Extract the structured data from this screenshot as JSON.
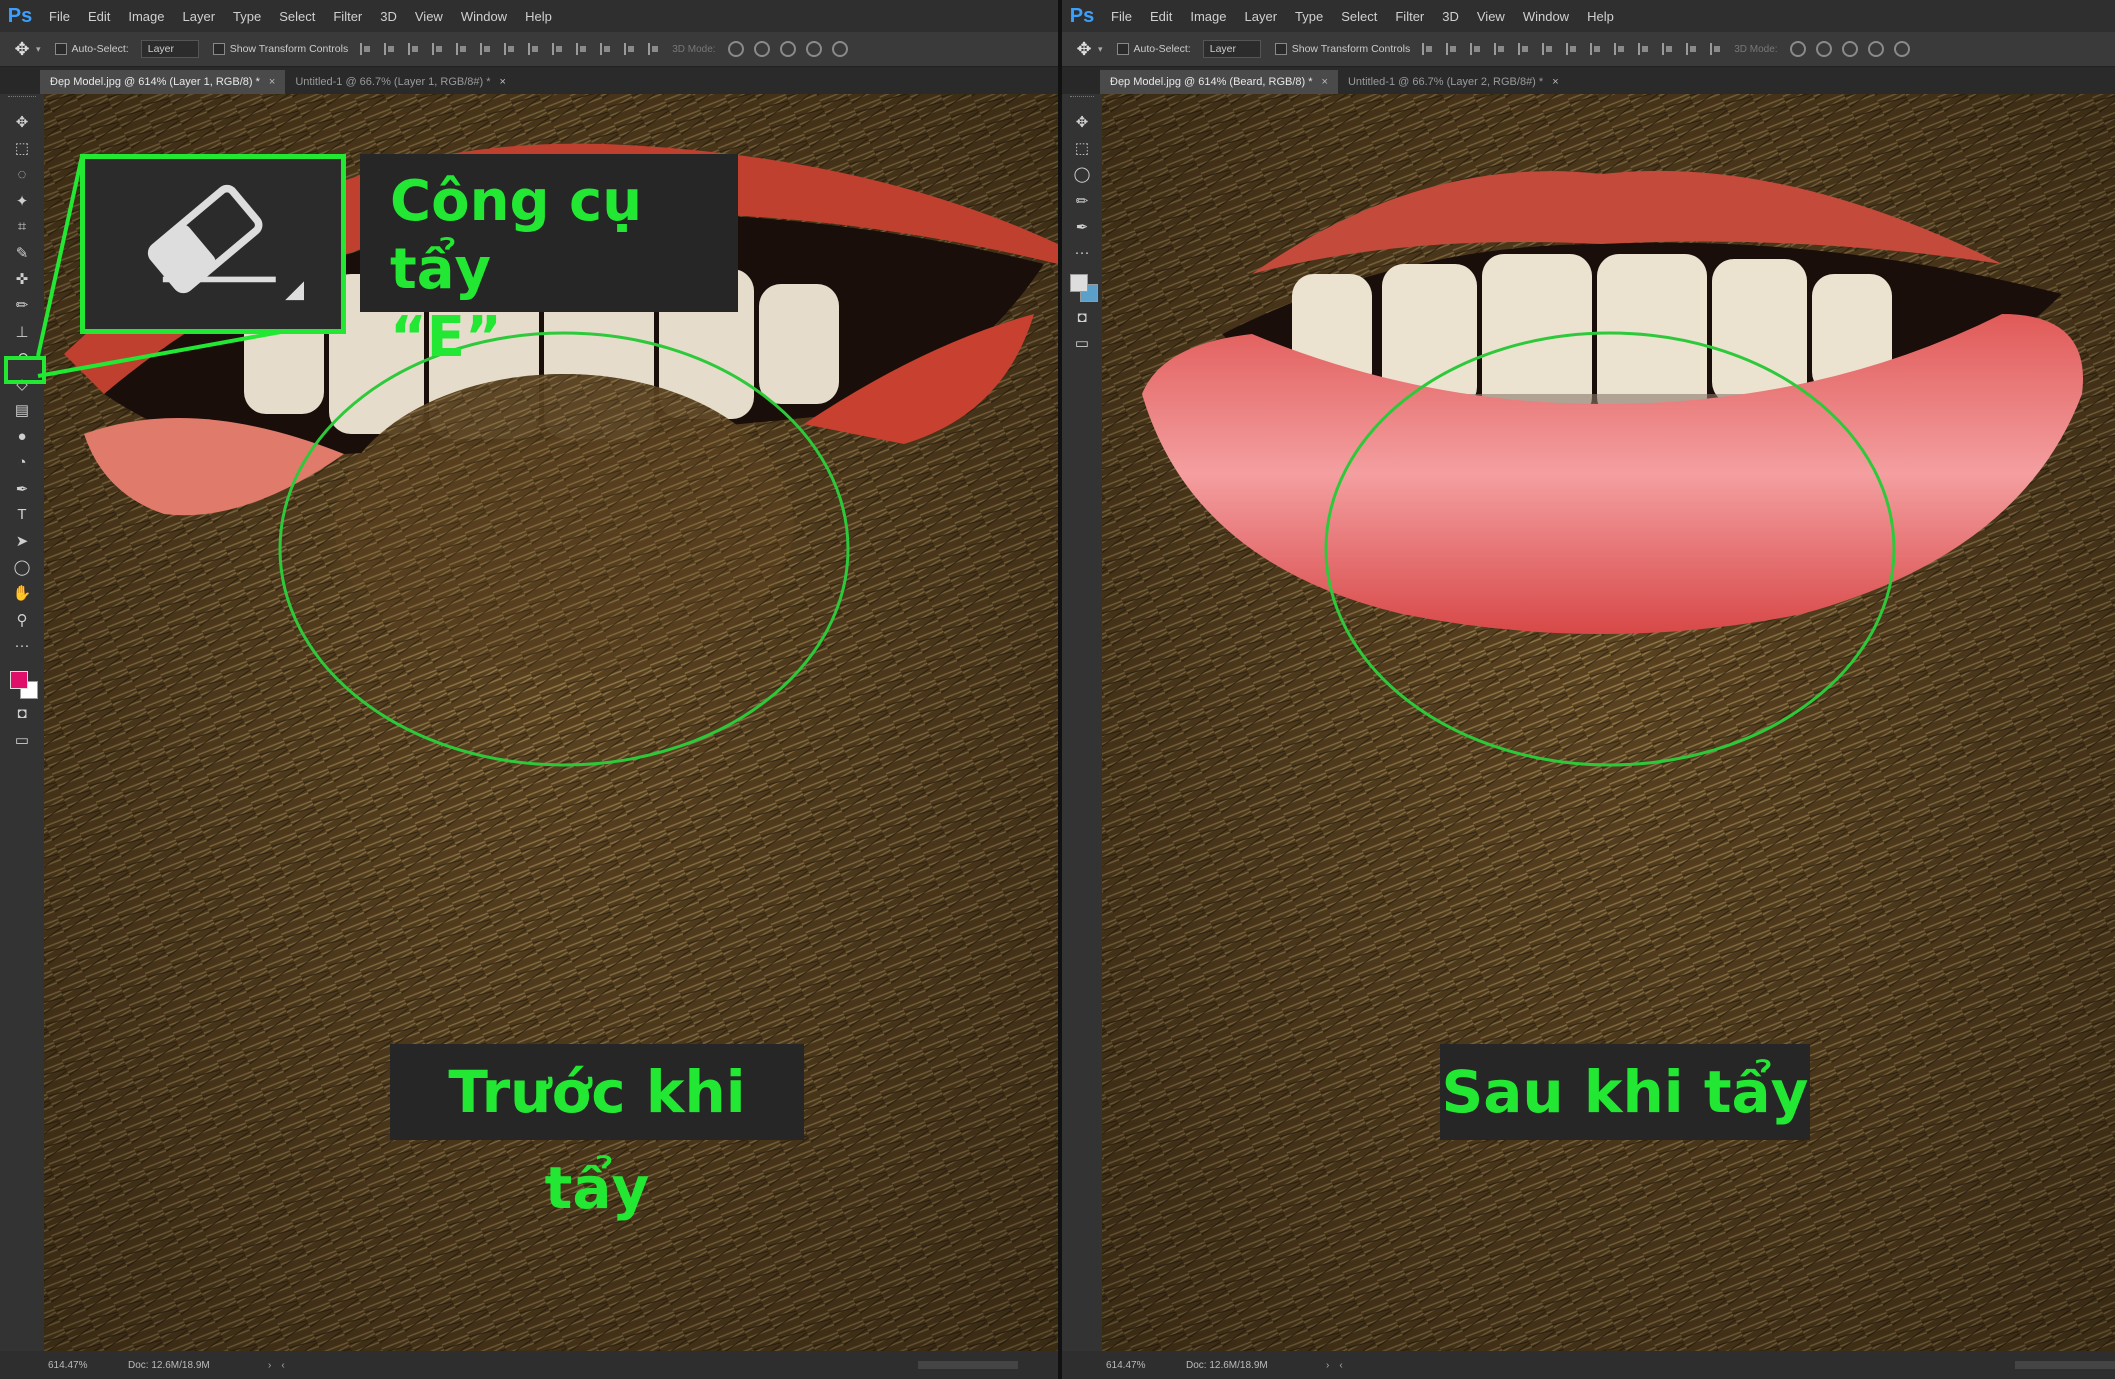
{
  "menu": [
    "File",
    "Edit",
    "Image",
    "Layer",
    "Type",
    "Select",
    "Filter",
    "3D",
    "View",
    "Window",
    "Help"
  ],
  "app_logo": "Ps",
  "options": {
    "auto_select_label": "Auto-Select:",
    "layer_select": "Layer",
    "transform_label": "Show Transform Controls",
    "mode_3d": "3D Mode:"
  },
  "left": {
    "tabs": [
      {
        "label": "Đẹp Model.jpg @ 614% (Layer 1, RGB/8) *",
        "close": "×"
      },
      {
        "label": "Untitled-1 @ 66.7% (Layer 1, RGB/8#) *",
        "close": "×"
      }
    ],
    "caption": "Trước khi tẩy",
    "callout_text_line1": "Công cụ tẩy",
    "callout_text_line2": "“E”",
    "status_zoom": "614.47%",
    "status_doc": "Doc: 12.6M/18.9M"
  },
  "right": {
    "tabs": [
      {
        "label": "Đẹp Model.jpg @ 614% (Beard, RGB/8) *",
        "close": "×"
      },
      {
        "label": "Untitled-1 @ 66.7% (Layer 2, RGB/8#) *",
        "close": "×"
      }
    ],
    "caption": "Sau khi tẩy",
    "status_zoom": "614.47%",
    "status_doc": "Doc: 12.6M/18.9M"
  },
  "colors": {
    "highlight": "#22e833",
    "foreground": "#e0106a",
    "background": "#ffffff"
  },
  "icons": {
    "tools_left": [
      "move-tool-icon",
      "marquee-tool-icon",
      "lasso-tool-icon",
      "magic-wand-icon",
      "crop-tool-icon",
      "eyedropper-icon",
      "patch-tool-icon",
      "brush-tool-icon",
      "clone-stamp-icon",
      "history-brush-icon",
      "eraser-tool-icon",
      "gradient-tool-icon",
      "blur-tool-icon",
      "dodge-tool-icon",
      "pen-tool-icon",
      "type-tool-icon",
      "path-selection-icon",
      "ellipse-tool-icon",
      "hand-tool-icon",
      "zoom-tool-icon",
      "more-tools-icon"
    ],
    "tools_right": [
      "move-tool-icon",
      "marquee-tool-icon",
      "ellipse-tool-icon",
      "brush-tool-icon",
      "pen-tool-icon",
      "more-tools-icon"
    ]
  }
}
